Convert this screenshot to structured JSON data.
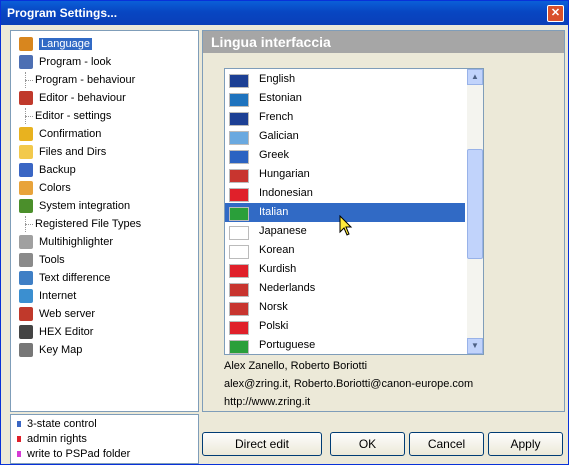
{
  "window": {
    "title": "Program Settings...",
    "close_glyph": "✕"
  },
  "tree": [
    {
      "label": "Language",
      "icon": "people-icon",
      "child": false,
      "selected": true,
      "color": "#d8861e"
    },
    {
      "label": "Program - look",
      "icon": "layout-icon",
      "child": false,
      "color": "#4d6fb3"
    },
    {
      "label": "Program - behaviour",
      "child": true
    },
    {
      "label": "Editor - behaviour",
      "icon": "pencil-icon",
      "child": false,
      "color": "#c0392b"
    },
    {
      "label": "Editor - settings",
      "child": true
    },
    {
      "label": "Confirmation",
      "icon": "speech-bubble-icon",
      "child": false,
      "color": "#e8b21f"
    },
    {
      "label": "Files and Dirs",
      "icon": "folder-icon",
      "child": false,
      "color": "#f2c94c"
    },
    {
      "label": "Backup",
      "icon": "disk-icon",
      "child": false,
      "color": "#3a66c4"
    },
    {
      "label": "Colors",
      "icon": "palette-icon",
      "child": false,
      "color": "#e8a33b"
    },
    {
      "label": "System integration",
      "icon": "windows-icon",
      "child": false,
      "color": "#4b8f2b"
    },
    {
      "label": "Registered File Types",
      "child": true
    },
    {
      "label": "Multihighlighter",
      "icon": "document-icon",
      "child": false,
      "color": "#a0a0a0"
    },
    {
      "label": "Tools",
      "icon": "gear-icon",
      "child": false,
      "color": "#8a8a8a"
    },
    {
      "label": "Text difference",
      "icon": "compare-icon",
      "child": false,
      "color": "#3f7fc5"
    },
    {
      "label": "Internet",
      "icon": "globe-icon",
      "child": false,
      "color": "#3b8fd0"
    },
    {
      "label": "Web server",
      "icon": "feather-icon",
      "child": false,
      "color": "#c0392b"
    },
    {
      "label": "HEX Editor",
      "icon": "binary-icon",
      "child": false,
      "color": "#444"
    },
    {
      "label": "Key Map",
      "icon": "key-icon",
      "child": false,
      "color": "#777"
    }
  ],
  "legend": [
    {
      "label": "3-state control",
      "color": "#3a66c4"
    },
    {
      "label": "admin rights",
      "color": "#e0202a"
    },
    {
      "label": "write to PSPad folder",
      "color": "#d63ad6"
    }
  ],
  "panel": {
    "title": "Lingua interfaccia",
    "languages": [
      {
        "label": "English",
        "flag": "#1c3f94"
      },
      {
        "label": "Estonian",
        "flag": "#1e73be"
      },
      {
        "label": "French",
        "flag": "#1c3f94"
      },
      {
        "label": "Galician",
        "flag": "#6aa9e0"
      },
      {
        "label": "Greek",
        "flag": "#2b63c2"
      },
      {
        "label": "Hungarian",
        "flag": "#c8352f"
      },
      {
        "label": "Indonesian",
        "flag": "#e0202a"
      },
      {
        "label": "Italian",
        "flag": "#2a9f3a",
        "active": true
      },
      {
        "label": "Japanese",
        "flag": "#ffffff"
      },
      {
        "label": "Korean",
        "flag": "#ffffff"
      },
      {
        "label": "Kurdish",
        "flag": "#e0202a"
      },
      {
        "label": "Nederlands",
        "flag": "#c8352f"
      },
      {
        "label": "Norsk",
        "flag": "#c8352f"
      },
      {
        "label": "Polski",
        "flag": "#e0202a"
      },
      {
        "label": "Portuguese",
        "flag": "#2a9f3a"
      }
    ],
    "credits": "Alex Zanello, Roberto Boriotti",
    "emails": "alex@zring.it, Roberto.Boriotti@canon-europe.com",
    "url": "http://www.zring.it"
  },
  "buttons": {
    "direct_edit": "Direct edit",
    "ok": "OK",
    "cancel": "Cancel",
    "apply": "Apply"
  },
  "scroll": {
    "up": "▲",
    "down": "▼"
  }
}
